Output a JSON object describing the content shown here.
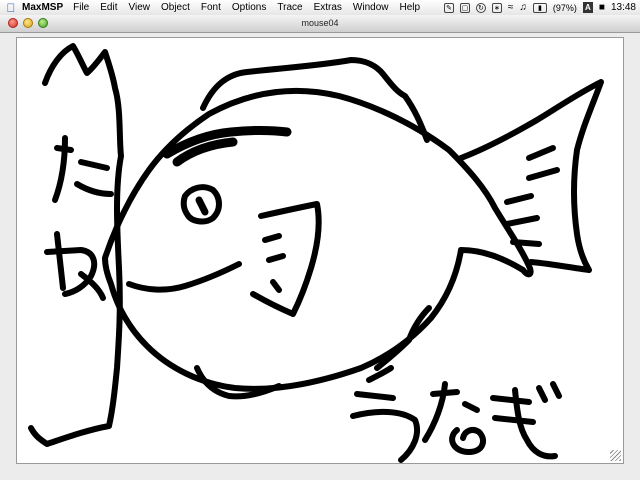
{
  "menubar": {
    "apple_icon": "apple-icon",
    "app_name": "MaxMSP",
    "menus": [
      "File",
      "Edit",
      "View",
      "Object",
      "Font",
      "Options",
      "Trace",
      "Extras",
      "Window",
      "Help"
    ],
    "status": {
      "battery_percent": "(97%)",
      "input_letter": "A",
      "clock": "13:48"
    }
  },
  "window": {
    "title": "mouse04"
  },
  "drawing": {
    "description_icon": "freehand-fish-drawing",
    "stroke_color": "#000000",
    "background_color": "#ffffff"
  }
}
